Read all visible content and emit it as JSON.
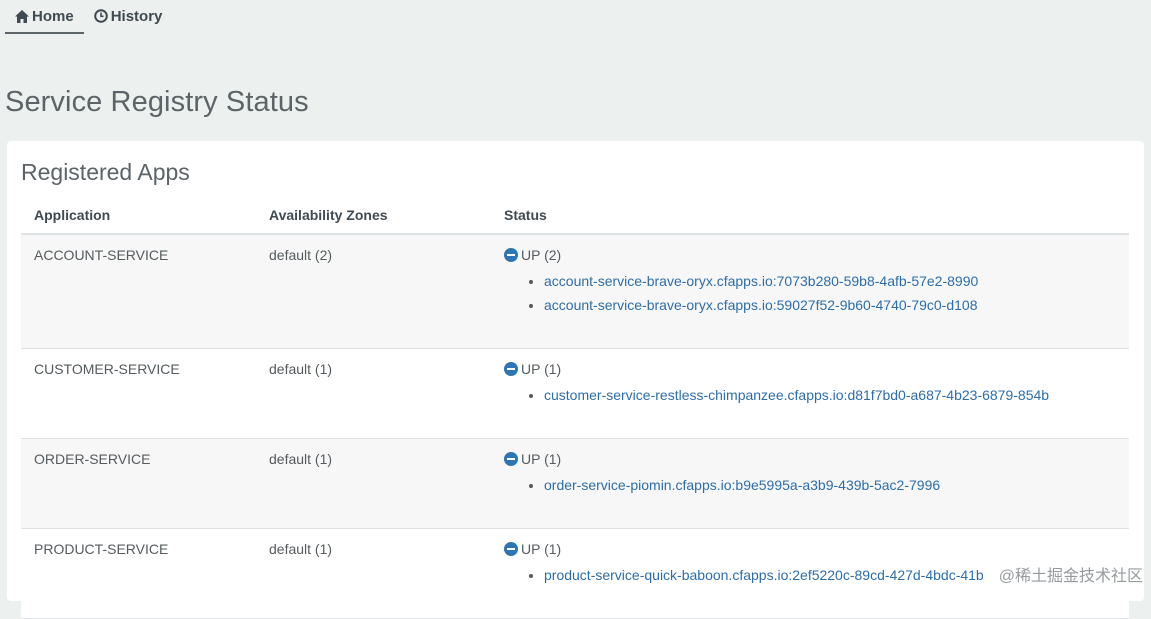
{
  "nav": {
    "items": [
      {
        "label": "Home",
        "icon": "house-icon",
        "active": true
      },
      {
        "label": "History",
        "icon": "clock-icon",
        "active": false
      }
    ]
  },
  "page_title": "Service Registry Status",
  "registered_apps": {
    "title": "Registered Apps",
    "headers": [
      "Application",
      "Availability Zones",
      "Status"
    ],
    "rows": [
      {
        "application": "ACCOUNT-SERVICE",
        "zones": "default (2)",
        "status": "UP (2)",
        "instances": [
          "account-service-brave-oryx.cfapps.io:7073b280-59b8-4afb-57e2-8990",
          "account-service-brave-oryx.cfapps.io:59027f52-9b60-4740-79c0-d108"
        ]
      },
      {
        "application": "CUSTOMER-SERVICE",
        "zones": "default (1)",
        "status": "UP (1)",
        "instances": [
          "customer-service-restless-chimpanzee.cfapps.io:d81f7bd0-a687-4b23-6879-854b"
        ]
      },
      {
        "application": "ORDER-SERVICE",
        "zones": "default (1)",
        "status": "UP (1)",
        "instances": [
          "order-service-piomin.cfapps.io:b9e5995a-a3b9-439b-5ac2-7996"
        ]
      },
      {
        "application": "PRODUCT-SERVICE",
        "zones": "default (1)",
        "status": "UP (1)",
        "instances": [
          "product-service-quick-baboon.cfapps.io:2ef5220c-89cd-427d-4bdc-41b"
        ]
      }
    ]
  },
  "watermark": "@稀土掘金技术社区",
  "colors": {
    "background": "#ecf0ef",
    "link": "#2d6ea8",
    "status_icon": "#2d76b3"
  }
}
